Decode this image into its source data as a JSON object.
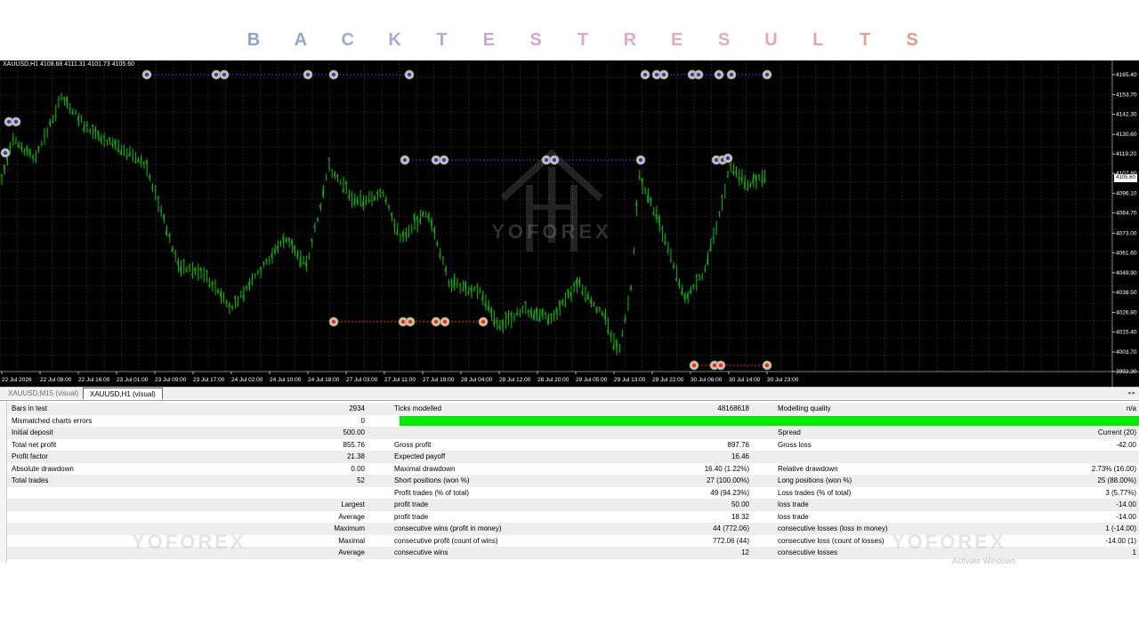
{
  "banner": {
    "letters": [
      "B",
      "A",
      "C",
      "K",
      "T",
      "E",
      "S",
      "T",
      "R",
      "E",
      "S",
      "U",
      "L",
      "T",
      "S"
    ],
    "colors": [
      "#8ea3d0",
      "#95a6d2",
      "#9fa9d4",
      "#aaaad6",
      "#b8aad6",
      "#c6a9d4",
      "#d2a8d2",
      "#daa9cf",
      "#e0a9c6",
      "#e4a8bf",
      "#e8a8b8",
      "#eaa6b0",
      "#eaa3a6",
      "#ea9f9d",
      "#ea9592"
    ]
  },
  "chart": {
    "info": "XAUUSD,H1  4108.68 4111.31 4101.73 4105.60",
    "watermark": "YOFOREX",
    "current_price": "4105.60",
    "price_labels": [
      "4165.40",
      "4153.70",
      "4142.30",
      "4130.60",
      "4119.20",
      "4107.80",
      "4096.10",
      "4084.70",
      "4073.00",
      "4061.60",
      "4049.90",
      "4038.50",
      "4026.80",
      "4015.40",
      "4003.70",
      "3992.30"
    ],
    "time_labels": [
      "22 Jul 2026",
      "22 Jul 08:00",
      "22 Jul 16:00",
      "23 Jul 01:00",
      "23 Jul 09:00",
      "23 Jul 17:00",
      "24 Jul 02:00",
      "24 Jul 10:00",
      "24 Jul 18:00",
      "27 Jul 03:00",
      "27 Jul 11:00",
      "27 Jul 19:00",
      "28 Jul 04:00",
      "28 Jul 12:00",
      "28 Jul 20:00",
      "29 Jul 05:00",
      "29 Jul 13:00",
      "29 Jul 22:00",
      "30 Jul 06:00",
      "30 Jul 14:00",
      "30 Jul 23:00"
    ],
    "colors": {
      "background": "#000000",
      "grid": "#3a3a3a",
      "candle": "#00c400",
      "buy_line": "#3030ff",
      "sell_line": "#ff2020"
    }
  },
  "tabs": [
    {
      "label": "XAUUSD,M15 (visual)",
      "active": false
    },
    {
      "label": "XAUUSD,H1 (visual)",
      "active": true
    }
  ],
  "tab_arrows": "◂ ▸",
  "report": {
    "rows": [
      [
        "Bars in test",
        "2934",
        "Ticks modelled",
        "48168618",
        "Modelling quality",
        "n/a"
      ],
      [
        "Mismatched charts errors",
        "0",
        "",
        "",
        "",
        ""
      ],
      [
        "Initial deposit",
        "500.00",
        "",
        "",
        "Spread",
        "Current (20)"
      ],
      [
        "Total net profit",
        "855.76",
        "Gross profit",
        "897.76",
        "Gross loss",
        "-42.00"
      ],
      [
        "Profit factor",
        "21.38",
        "Expected payoff",
        "16.46",
        "",
        ""
      ],
      [
        "Absolute drawdown",
        "0.00",
        "Maximal drawdown",
        "16.40 (1.22%)",
        "Relative drawdown",
        "2.73% (16.00)"
      ],
      [
        "Total trades",
        "52",
        "Short positions (won %)",
        "27 (100.00%)",
        "Long positions (won %)",
        "25 (88.00%)"
      ],
      [
        "",
        "",
        "Profit trades (% of total)",
        "49 (94.23%)",
        "Loss trades (% of total)",
        "3 (5.77%)"
      ],
      [
        "",
        "Largest",
        "profit trade",
        "50.00",
        "loss trade",
        "-14.00"
      ],
      [
        "",
        "Average",
        "profit trade",
        "18.32",
        "loss trade",
        "-14.00"
      ],
      [
        "",
        "Maximum",
        "consecutive wins (profit in money)",
        "44 (772.06)",
        "consecutive losses (loss in money)",
        "1 (-14.00)"
      ],
      [
        "",
        "Maximal",
        "consecutive profit (count of wins)",
        "772.06 (44)",
        "consecutive loss (count of losses)",
        "-14.00 (1)"
      ],
      [
        "",
        "Average",
        "consecutive wins",
        "12",
        "consecutive losses",
        "1"
      ]
    ],
    "quality_bar_color": "#00ee00",
    "watermark": "YOFOREX"
  },
  "activate_windows": "Activate Windows"
}
